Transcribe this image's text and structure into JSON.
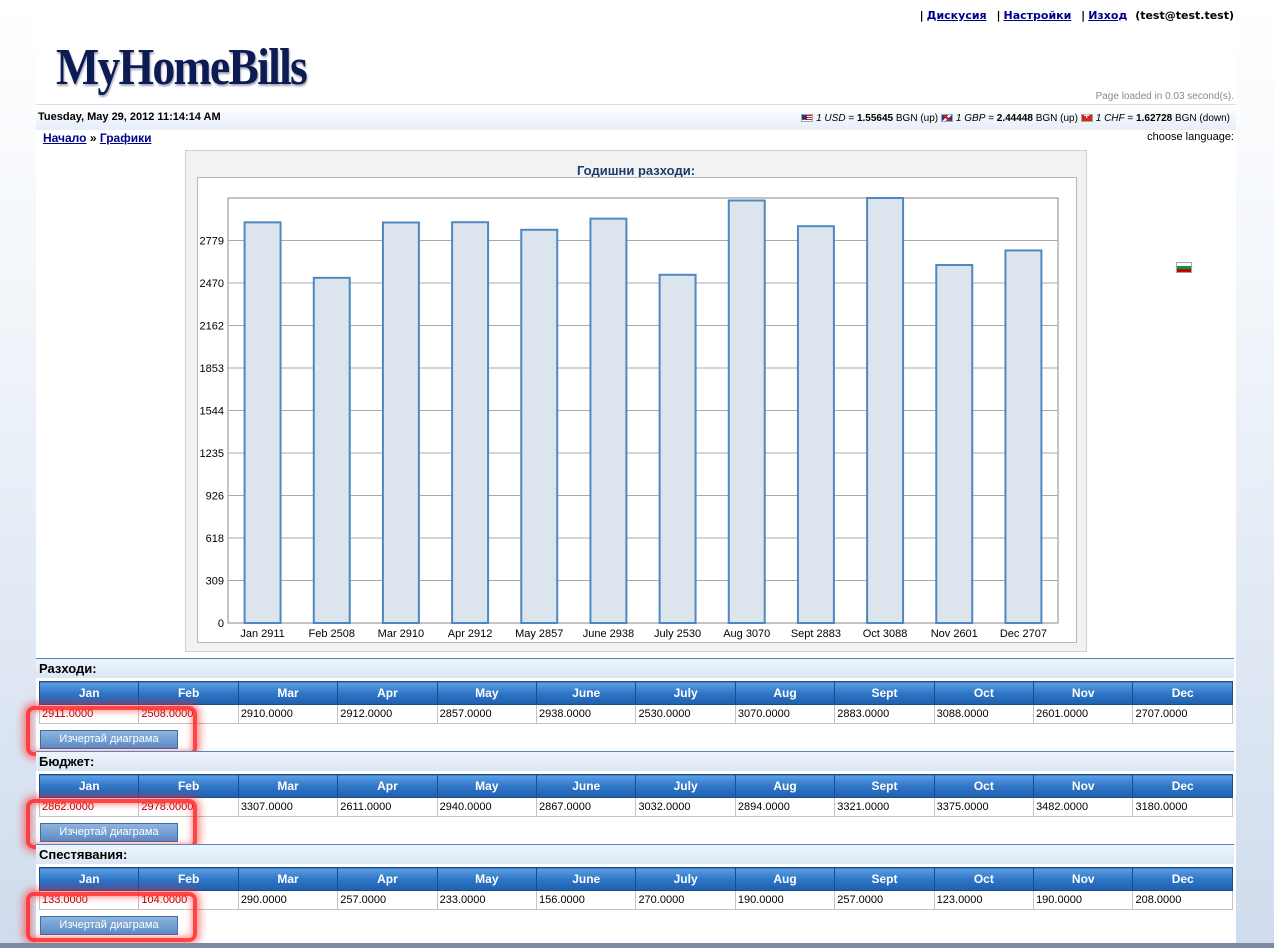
{
  "header": {
    "links": [
      {
        "label": "Дискусия"
      },
      {
        "label": "Настройки"
      },
      {
        "label": "Изход"
      }
    ],
    "user": "(test@test.test)",
    "logo": "MyHomeBills",
    "page_loaded": "Page loaded in 0.03 second(s)."
  },
  "datebar": {
    "date": "Tuesday, May 29, 2012 11:14:14 AM",
    "rates": [
      {
        "flag": "us-flag-icon",
        "label": "1 USD",
        "value": "1.55645",
        "suffix": "BGN (up)"
      },
      {
        "flag": "gb-flag-icon",
        "label": "1 GBP",
        "value": "2.44448",
        "suffix": "BGN (up)"
      },
      {
        "flag": "ch-flag-icon",
        "label": "1 CHF",
        "value": "1.62728",
        "suffix": "BGN (down)"
      }
    ]
  },
  "breadcrumb": {
    "home": "Начало",
    "sep": "»",
    "current": "Графики"
  },
  "language": {
    "label": "choose language:",
    "flags": [
      "gb-flag-icon",
      "de-flag-icon",
      "bg-flag-icon"
    ]
  },
  "chart_data": {
    "type": "bar",
    "title": "Годишни разходи:",
    "categories": [
      "Jan 2911",
      "Feb 2508",
      "Mar 2910",
      "Apr 2912",
      "May 2857",
      "June 2938",
      "July 2530",
      "Aug 3070",
      "Sept 2883",
      "Oct 3088",
      "Nov 2601",
      "Dec 2707"
    ],
    "values": [
      2911,
      2508,
      2910,
      2912,
      2857,
      2938,
      2530,
      3070,
      2883,
      3088,
      2601,
      2707
    ],
    "y_ticks": [
      0,
      309,
      618,
      926,
      1235,
      1544,
      1853,
      2162,
      2470,
      2779
    ],
    "ylim": [
      0,
      3088
    ],
    "grid": true,
    "bar_fill": "#dce4ee",
    "bar_stroke": "#4f88c0"
  },
  "sections": [
    {
      "title": "Разходи:",
      "button": "Изчертай диаграма",
      "headers": [
        "Jan",
        "Feb",
        "Mar",
        "Apr",
        "May",
        "June",
        "July",
        "Aug",
        "Sept",
        "Oct",
        "Nov",
        "Dec"
      ],
      "values": [
        "2911.0000",
        "2508.0000",
        "2910.0000",
        "2912.0000",
        "2857.0000",
        "2938.0000",
        "2530.0000",
        "3070.0000",
        "2883.0000",
        "3088.0000",
        "2601.0000",
        "2707.0000"
      ]
    },
    {
      "title": "Бюджет:",
      "button": "Изчертай диаграма",
      "headers": [
        "Jan",
        "Feb",
        "Mar",
        "Apr",
        "May",
        "June",
        "July",
        "Aug",
        "Sept",
        "Oct",
        "Nov",
        "Dec"
      ],
      "values": [
        "2862.0000",
        "2978.0000",
        "3307.0000",
        "2611.0000",
        "2940.0000",
        "2867.0000",
        "3032.0000",
        "2894.0000",
        "3321.0000",
        "3375.0000",
        "3482.0000",
        "3180.0000"
      ]
    },
    {
      "title": "Спестявания:",
      "button": "Изчертай диаграма",
      "headers": [
        "Jan",
        "Feb",
        "Mar",
        "Apr",
        "May",
        "June",
        "July",
        "Aug",
        "Sept",
        "Oct",
        "Nov",
        "Dec"
      ],
      "values": [
        "133.0000",
        "104.0000",
        "290.0000",
        "257.0000",
        "233.0000",
        "156.0000",
        "270.0000",
        "190.0000",
        "257.0000",
        "123.0000",
        "190.0000",
        "208.0000"
      ]
    }
  ],
  "colors": {
    "link": "#00008b",
    "highlight": "#ff2323",
    "table_header": "#2f76c8"
  }
}
